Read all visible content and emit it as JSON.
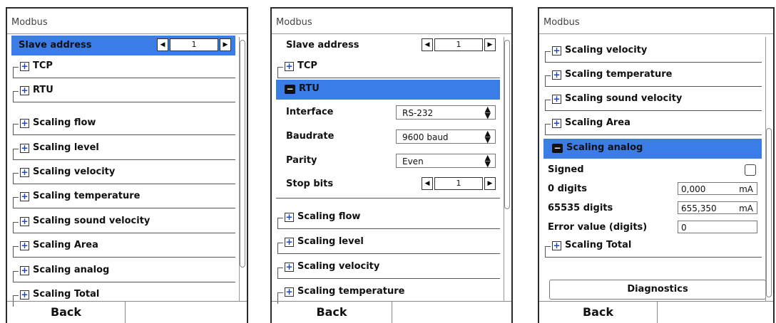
{
  "panel1": {
    "title": "Modbus",
    "slave_address": {
      "label": "Slave address",
      "value": "1"
    },
    "groups": [
      "TCP",
      "RTU",
      "Scaling flow",
      "Scaling level",
      "Scaling velocity",
      "Scaling temperature",
      "Scaling sound velocity",
      "Scaling Area",
      "Scaling analog",
      "Scaling Total"
    ],
    "back": "Back"
  },
  "panel2": {
    "title": "Modbus",
    "slave_address": {
      "label": "Slave address",
      "value": "1"
    },
    "tcp": "TCP",
    "rtu": "RTU",
    "interface": {
      "label": "Interface",
      "value": "RS-232"
    },
    "baudrate": {
      "label": "Baudrate",
      "value": "9600 baud"
    },
    "parity": {
      "label": "Parity",
      "value": "Even"
    },
    "stop_bits": {
      "label": "Stop bits",
      "value": "1"
    },
    "groups": [
      "Scaling flow",
      "Scaling level",
      "Scaling velocity",
      "Scaling temperature"
    ],
    "back": "Back"
  },
  "panel3": {
    "title": "Modbus",
    "groups": [
      "Scaling velocity",
      "Scaling temperature",
      "Scaling sound velocity",
      "Scaling Area"
    ],
    "analog": "Scaling analog",
    "signed": {
      "label": "Signed",
      "checked": false
    },
    "zero_digits": {
      "label": "0 digits",
      "value": "0,000",
      "unit": "mA"
    },
    "max_digits": {
      "label": "65535 digits",
      "value": "655,350",
      "unit": "mA"
    },
    "error_value": {
      "label": "Error value (digits)",
      "value": "0"
    },
    "total": "Scaling Total",
    "diagnostics": "Diagnostics",
    "back": "Back"
  },
  "icons": {
    "expand": "plus-box-icon",
    "collapse": "minus-box-icon",
    "left": "arrow-left-icon",
    "right": "arrow-right-icon",
    "select": "up-down-icon"
  },
  "colors": {
    "selection": "#3b7de6",
    "text": "#111111"
  }
}
